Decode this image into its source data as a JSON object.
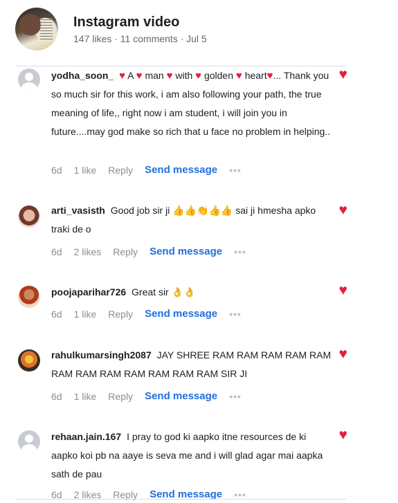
{
  "post": {
    "title": "Instagram video",
    "meta": "147 likes · 11 comments · Jul 5"
  },
  "heart_color": "#e41e3f",
  "link_color": "#216fdb",
  "comments": [
    {
      "username": "yodha_soon_",
      "text_parts": [
        "A",
        "man",
        "with",
        "golden",
        "heart",
        "... Thank you so much sir for this work, i am also following your path, the true meaning of life,, right now i am student, i will join you in future....may god make so rich that u face no problem in helping.."
      ],
      "time": "6d",
      "likes": "1 like",
      "reply": "Reply",
      "send": "Send message",
      "more": "•••"
    },
    {
      "username": "arti_vasisth",
      "text": "Good job sir ji",
      "emoji": "👍👍👏👍👍",
      "text_after": "sai ji hmesha apko traki de o",
      "time": "6d",
      "likes": "2 likes",
      "reply": "Reply",
      "send": "Send message",
      "more": "•••"
    },
    {
      "username": "poojaparihar726",
      "text": "Great sir",
      "emoji": "👌👌",
      "time": "6d",
      "likes": "1 like",
      "reply": "Reply",
      "send": "Send message",
      "more": "•••"
    },
    {
      "username": "rahulkumarsingh2087",
      "text": "JAY SHREE RAM RAM RAM RAM RAM RAM RAM RAM RAM RAM RAM RAM SIR JI",
      "time": "6d",
      "likes": "1 like",
      "reply": "Reply",
      "send": "Send message",
      "more": "•••"
    },
    {
      "username": "rehaan.jain.167",
      "text": "I pray to god ki aapko itne resources de ki aapko koi pb na aaye is seva me and i will glad agar mai aapka sath de pau",
      "time": "6d",
      "likes": "2 likes",
      "reply": "Reply",
      "send": "Send message",
      "more": "•••"
    }
  ]
}
